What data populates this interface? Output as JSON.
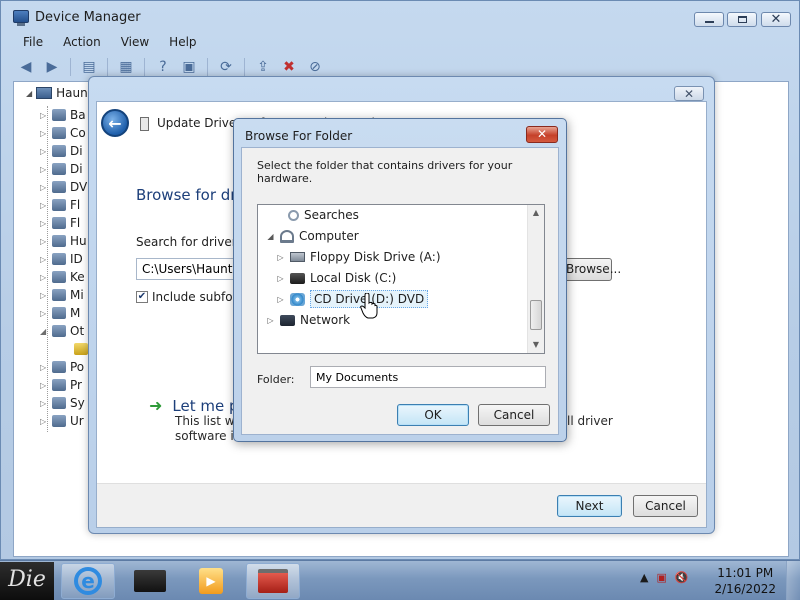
{
  "device_manager": {
    "title": "Device Manager",
    "menu": [
      "File",
      "Action",
      "View",
      "Help"
    ],
    "root_label": "Haunt",
    "categories": [
      "Ba",
      "Co",
      "Di",
      "Di",
      "DV",
      "Fl",
      "Fl",
      "Hu",
      "ID",
      "Ke",
      "Mi",
      "M",
      "Ot",
      "",
      "Po",
      "Pr",
      "Sy",
      "Ur"
    ]
  },
  "wizard": {
    "title": "Update Driver Software - Other Devices",
    "heading": "Browse for dri",
    "search_label": "Search for driver so",
    "path_value": "C:\\Users\\Haunted",
    "browse_button": "Browse...",
    "include_subfolders": "Include subfold",
    "let_me_pick": "Let me pic",
    "desc_line1": "This list will s",
    "desc_line1_tail": "ll driver",
    "desc_line2": "software in t",
    "next_button": "Next",
    "cancel_button": "Cancel"
  },
  "browse_dialog": {
    "title": "Browse For Folder",
    "instruction": "Select the folder that contains drivers for your hardware.",
    "tree": {
      "searches": "Searches",
      "computer": "Computer",
      "floppy": "Floppy Disk Drive (A:)",
      "local_disk": "Local Disk (C:)",
      "cd_drive": "CD Drive (D:) DVD",
      "network": "Network"
    },
    "folder_label": "Folder:",
    "folder_value": "My Documents",
    "ok_button": "OK",
    "cancel_button": "Cancel"
  },
  "taskbar": {
    "start_label": "Die",
    "time": "11:01 PM",
    "date": "2/16/2022"
  }
}
